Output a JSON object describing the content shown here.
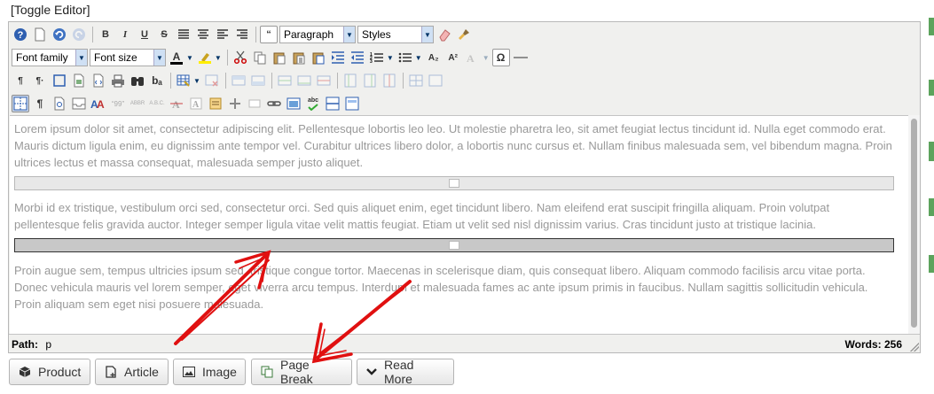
{
  "toggle_editor": "[Toggle Editor]",
  "toolbar": {
    "row1": {
      "bold": "B",
      "italic": "I",
      "underline": "U",
      "strike": "S",
      "quote": "“",
      "format_select": "Paragraph",
      "styles_select": "Styles"
    },
    "row2": {
      "font_family": "Font family",
      "font_size": "Font size",
      "text_color": "A",
      "subscript": "A₂",
      "superscript": "A²",
      "omega": "Ω"
    },
    "row3": {
      "show_blocks": "¶",
      "pilcrow_rtl": "¶·",
      "text_dir": "bₐ"
    },
    "row4": {
      "pilcrow": "¶",
      "tag_abbr": "“99”",
      "tag_abbr2": "ABBR",
      "tag_acronym": "A.B.C.",
      "spell_check": "abc"
    }
  },
  "content": {
    "paragraphs": [
      "Lorem ipsum dolor sit amet, consectetur adipiscing elit. Pellentesque lobortis leo leo. Ut molestie pharetra leo, sit amet feugiat lectus tincidunt id. Nulla eget commodo erat. Mauris dictum ligula enim, eu dignissim ante tempor vel. Curabitur ultrices libero dolor, a lobortis nunc cursus et. Nullam finibus malesuada sem, vel bibendum magna. Proin ultrices lectus et massa consequat, malesuada semper justo aliquet.",
      "Morbi id ex tristique, vestibulum orci sed, consectetur orci. Sed quis aliquet enim, eget tincidunt libero. Nam eleifend erat suscipit fringilla aliquam. Proin volutpat pellentesque felis gravida auctor. Integer semper ligula vitae velit mattis feugiat. Etiam ut velit sed nisl dignissim varius. Cras tincidunt justo at tristique lacinia.",
      "Proin augue sem, tempus ultricies ipsum sed, tristique congue tortor. Maecenas in scelerisque diam, quis consequat libero. Aliquam commodo facilisis arcu vitae porta. Donec vehicula mauris vel lorem semper, eget viverra arcu tempus. Interdum et malesuada fames ac ante ipsum primis in faucibus. Nullam sagittis sollicitudin vehicula. Proin aliquam sem eget nisi posuere malesuada."
    ]
  },
  "status": {
    "path_label": "Path:",
    "path_value": "p",
    "words_label": "Words:",
    "words_value": "256"
  },
  "buttons": [
    {
      "label": "Product",
      "icon": "cube-icon"
    },
    {
      "label": "Article",
      "icon": "file-plus-icon"
    },
    {
      "label": "Image",
      "icon": "picture-icon"
    },
    {
      "label": "Page Break",
      "icon": "copy-icon"
    },
    {
      "label": "Read More",
      "icon": "chevron-down-icon"
    }
  ],
  "colors": {
    "editor_bg": "#f0f0ee",
    "arrow_red": "#e01010",
    "accent_green": "#5ca35c"
  }
}
